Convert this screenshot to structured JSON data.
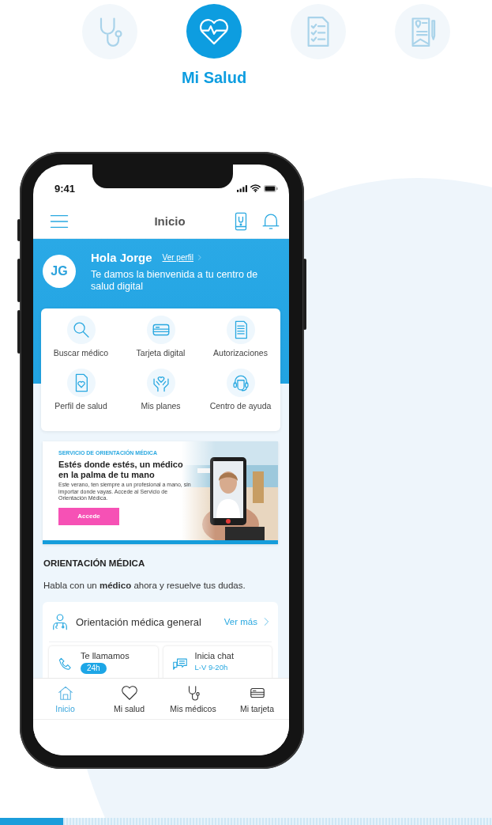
{
  "top_tabs": [
    {
      "selected": false
    },
    {
      "selected": true,
      "label": "Mi Salud"
    },
    {
      "selected": false
    },
    {
      "selected": false
    }
  ],
  "status_bar": {
    "time": "9:41"
  },
  "header": {
    "title": "Inicio"
  },
  "greeting": {
    "initials": "JG",
    "title": "Hola Jorge",
    "profile_link": "Ver perfil",
    "message": "Te damos la bienvenida a tu centro de salud digital"
  },
  "quick_actions": [
    {
      "label": "Buscar médico"
    },
    {
      "label": "Tarjeta digital"
    },
    {
      "label": "Autorizaciones"
    },
    {
      "label": "Perfil de salud"
    },
    {
      "label": "Mis planes"
    },
    {
      "label": "Centro de ayuda"
    }
  ],
  "promo": {
    "eyebrow": "SERVICIO DE ORIENTACIÓN MÉDICA",
    "title": "Estés donde estés, un médico en la palma de tu mano",
    "body": "Este verano, ten siempre a un profesional a mano, sin importar donde vayas. Accede al Servicio de Orientación Médica.",
    "button": "Accede"
  },
  "section": {
    "title": "ORIENTACIÓN MÉDICA",
    "text": "Habla con un **médico** ahora y resuelve tus dudas."
  },
  "service_card": {
    "title": "Orientación médica general",
    "link": "Ver más",
    "options": [
      {
        "kind": "badge",
        "title": "Te llamamos",
        "detail": "24h"
      },
      {
        "kind": "note",
        "title": "Inicia chat",
        "detail": "L-V 9-20h"
      }
    ]
  },
  "bottom_nav": [
    {
      "label": "Inicio",
      "selected": true
    },
    {
      "label": "Mi salud",
      "selected": false
    },
    {
      "label": "Mis médicos",
      "selected": false
    },
    {
      "label": "Mi tarjeta",
      "selected": false
    }
  ]
}
